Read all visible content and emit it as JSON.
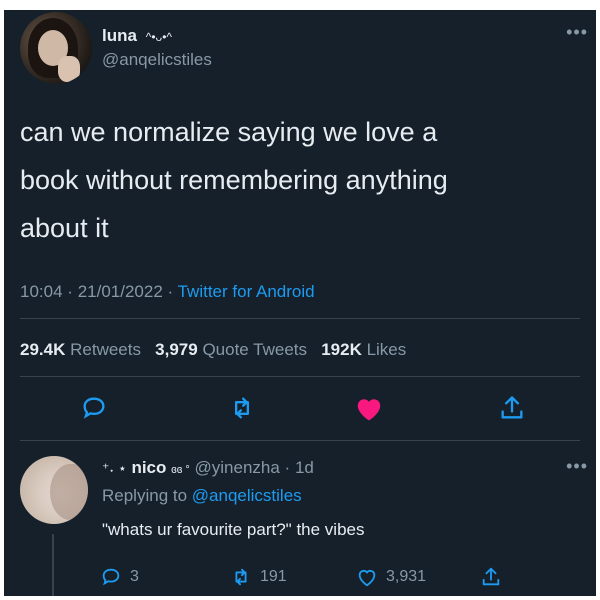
{
  "tweet": {
    "author_name": "luna",
    "author_name_emoji": "^•ᴗ•^",
    "handle": "@anqelicstiles",
    "more": "•••",
    "text_lines": [
      "can we normalize saying we love a",
      "book without remembering anything",
      "about it"
    ],
    "time": "10:04",
    "date": "21/01/2022",
    "separator": "·",
    "client": "Twitter for Android",
    "stats": {
      "retweets_count": "29.4K",
      "retweets_label": "Retweets",
      "quotes_count": "3,979",
      "quotes_label": "Quote Tweets",
      "likes_count": "192K",
      "likes_label": "Likes"
    }
  },
  "reply": {
    "name_prefix": "⁺˖ ⋆",
    "author_name": "nico",
    "name_suffix": "ɞɞ °",
    "handle": "@yinenzha",
    "separator": "·",
    "time": "1d",
    "more": "•••",
    "replying_label": "Replying to",
    "replying_handle": "@anqelicstiles",
    "text": "\"whats ur favourite part?\" the vibes",
    "reply_count": "3",
    "retweet_count": "191",
    "like_count": "3,931"
  },
  "colors": {
    "background": "#15202b",
    "text": "#e7ecf0",
    "muted": "#8899a6",
    "accent": "#1d9bf0",
    "like": "#f91880",
    "divider": "#38444d"
  }
}
